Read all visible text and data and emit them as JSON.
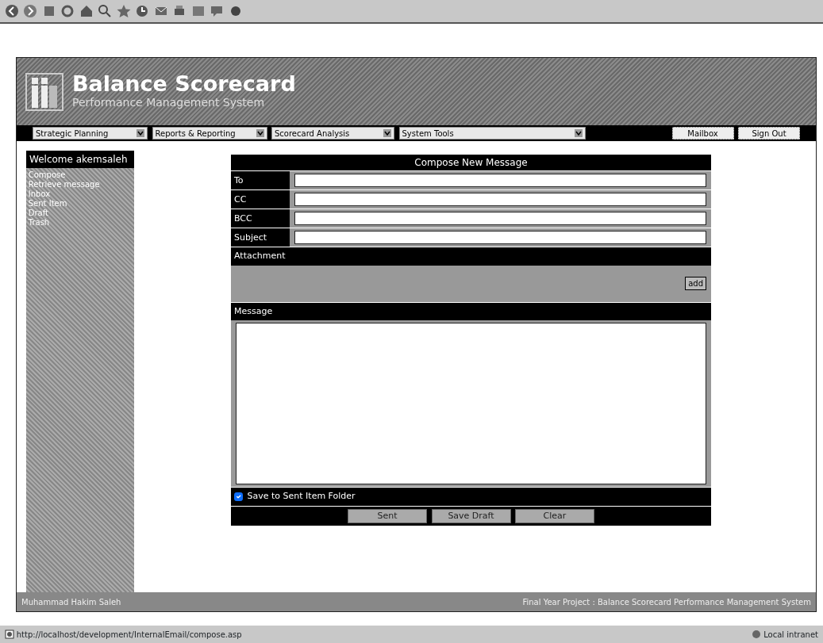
{
  "header": {
    "title": "Balance Scorecard",
    "subtitle": "Performance Management System"
  },
  "menus": [
    {
      "label": "Strategic Planning"
    },
    {
      "label": "Reports & Reporting"
    },
    {
      "label": "Scorecard Analysis"
    },
    {
      "label": "System Tools"
    }
  ],
  "nav_buttons": [
    "Mailbox",
    "Sign Out"
  ],
  "sidebar": {
    "welcome": "Welcome akemsaleh",
    "items": [
      "Compose",
      "Retrieve message",
      "Inbox",
      "Sent Item",
      "Draft",
      "Trash"
    ]
  },
  "compose": {
    "title": "Compose New Message",
    "fields": [
      {
        "label": "To"
      },
      {
        "label": "CC"
      },
      {
        "label": "BCC"
      },
      {
        "label": "Subject"
      }
    ],
    "attachment_label": "Attachment",
    "add_button": "add",
    "message_label": "Message",
    "save_to_sent": {
      "label": "Save to Sent Item Folder",
      "checked": true
    },
    "buttons": [
      "Sent",
      "Save Draft",
      "Clear"
    ]
  },
  "footer": {
    "left": "Muhammad Hakim Saleh",
    "right": "Final Year Project : Balance Scorecard Performance Management System"
  },
  "status_bar": {
    "url": "http://localhost/development/InternalEmail/compose.asp",
    "zone": "Local intranet"
  }
}
